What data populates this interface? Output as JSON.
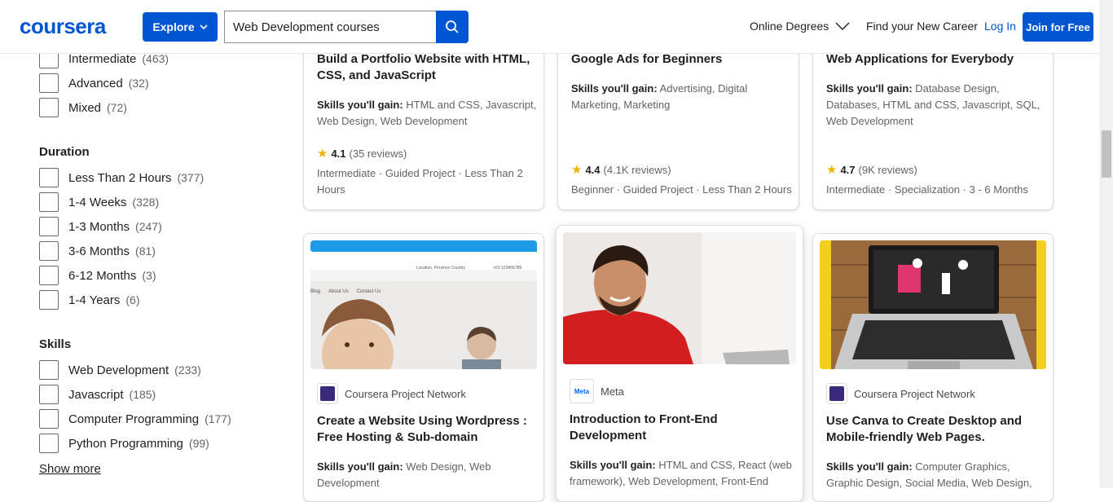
{
  "header": {
    "logo": "coursera",
    "explore_label": "Explore",
    "search_value": "Web Development courses",
    "nav_online": "Online Degrees",
    "nav_career": "Find your New Career",
    "nav_login": "Log In",
    "join_label": "Join for Free"
  },
  "filters": {
    "level_items": [
      {
        "label": "Intermediate",
        "count": "(463)"
      },
      {
        "label": "Advanced",
        "count": "(32)"
      },
      {
        "label": "Mixed",
        "count": "(72)"
      }
    ],
    "duration_heading": "Duration",
    "duration_items": [
      {
        "label": "Less Than 2 Hours",
        "count": "(377)"
      },
      {
        "label": "1-4 Weeks",
        "count": "(328)"
      },
      {
        "label": "1-3 Months",
        "count": "(247)"
      },
      {
        "label": "3-6 Months",
        "count": "(81)"
      },
      {
        "label": "6-12 Months",
        "count": "(3)"
      },
      {
        "label": "1-4 Years",
        "count": "(6)"
      }
    ],
    "skills_heading": "Skills",
    "skills_items": [
      {
        "label": "Web Development",
        "count": "(233)"
      },
      {
        "label": "Javascript",
        "count": "(185)"
      },
      {
        "label": "Computer Programming",
        "count": "(177)"
      },
      {
        "label": "Python Programming",
        "count": "(99)"
      }
    ],
    "show_more": "Show more"
  },
  "cards_top": [
    {
      "title_l1": "Build a Portfolio Website with HTML,",
      "title_l2": "CSS, and JavaScript",
      "skills_label": "Skills you'll gain:",
      "skills_l1": " HTML and CSS, Javascript,",
      "skills_l2": "Web Design, Web Development",
      "rating": "4.1",
      "reviews": "(35 reviews)",
      "meta_l1": "Intermediate · Guided Project · Less Than 2",
      "meta_l2": "Hours"
    },
    {
      "title_l1": "Google Ads for Beginners",
      "skills_label": "Skills you'll gain:",
      "skills_l1": " Advertising, Digital",
      "skills_l2": "Marketing, Marketing",
      "rating": "4.4",
      "reviews": "(4.1K reviews)",
      "meta_l1": "Beginner · Guided Project · Less Than 2 Hours"
    },
    {
      "title_l1": "Web Applications for Everybody",
      "skills_label": "Skills you'll gain:",
      "skills_l1": " Database Design,",
      "skills_l2": "Databases, HTML and CSS, Javascript, SQL,",
      "skills_l3": "Web Development",
      "rating": "4.7",
      "reviews": "(9K reviews)",
      "meta_l1": "Intermediate · Specialization · 3 - 6 Months"
    }
  ],
  "cards_bottom": [
    {
      "partner": "Coursera Project Network",
      "title_l1": "Create a Website Using Wordpress :",
      "title_l2": "Free Hosting & Sub-domain",
      "skills_label": "Skills you'll gain:",
      "skills_l1": " Web Design, Web",
      "skills_l2": "Development",
      "thumb_nav_text": "Location, Province Country",
      "thumb_phone": "+01-123456789",
      "thumb_links": [
        "Blog",
        "About Us",
        "Contact Us"
      ]
    },
    {
      "partner": "Meta",
      "partner_logo_text": "Meta",
      "title_l1": "Introduction to Front-End",
      "title_l2": "Development",
      "skills_label": "Skills you'll gain:",
      "skills_l1": " HTML and CSS, React (web",
      "skills_l2": "framework), Web Development, Front-End"
    },
    {
      "partner": "Coursera Project Network",
      "title_l1": "Use Canva to Create Desktop and",
      "title_l2": "Mobile-friendly Web Pages.",
      "skills_label": "Skills you'll gain:",
      "skills_l1": " Computer Graphics,",
      "skills_l2": "Graphic Design, Social Media, Web Design,"
    }
  ],
  "colors": {
    "brand": "#0056d2",
    "star": "#f0b400"
  }
}
